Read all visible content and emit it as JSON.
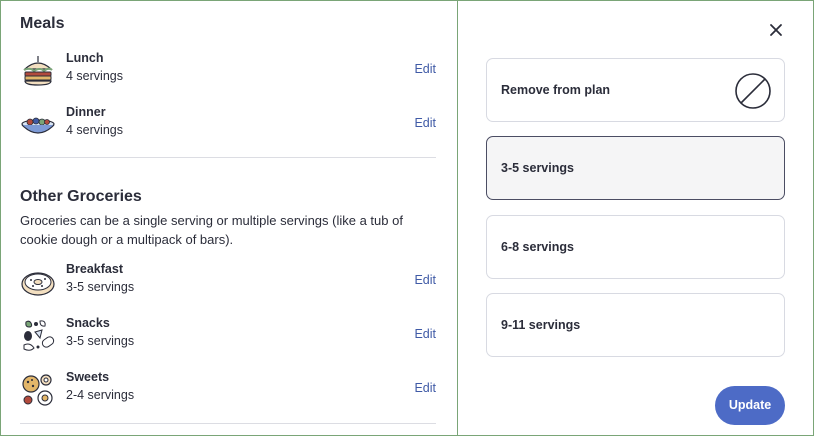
{
  "meals": {
    "title": "Meals",
    "items": [
      {
        "name": "Lunch",
        "servings": "4 servings",
        "edit": "Edit",
        "icon": "sandwich-icon"
      },
      {
        "name": "Dinner",
        "servings": "4 servings",
        "edit": "Edit",
        "icon": "bowl-icon"
      }
    ]
  },
  "groceries": {
    "title": "Other Groceries",
    "description": "Groceries can be a single serving or multiple servings (like a tub of cookie dough or a multipack of bars).",
    "items": [
      {
        "name": "Breakfast",
        "servings": "3-5 servings",
        "edit": "Edit",
        "icon": "bagel-icon"
      },
      {
        "name": "Snacks",
        "servings": "3-5 servings",
        "edit": "Edit",
        "icon": "snacks-icon"
      },
      {
        "name": "Sweets",
        "servings": "2-4 servings",
        "edit": "Edit",
        "icon": "cookies-icon"
      }
    ]
  },
  "panel": {
    "close_icon": "close-icon",
    "options": [
      {
        "label": "Remove from plan",
        "selected": false
      },
      {
        "label": "3-5 servings",
        "selected": true
      },
      {
        "label": "6-8 servings",
        "selected": false
      },
      {
        "label": "9-11 servings",
        "selected": false
      }
    ],
    "update_label": "Update"
  },
  "colors": {
    "accent": "#4d6bc6",
    "link": "#3f5aa6",
    "panel_border": "#7aa577",
    "selected_border": "#4b4d63"
  }
}
